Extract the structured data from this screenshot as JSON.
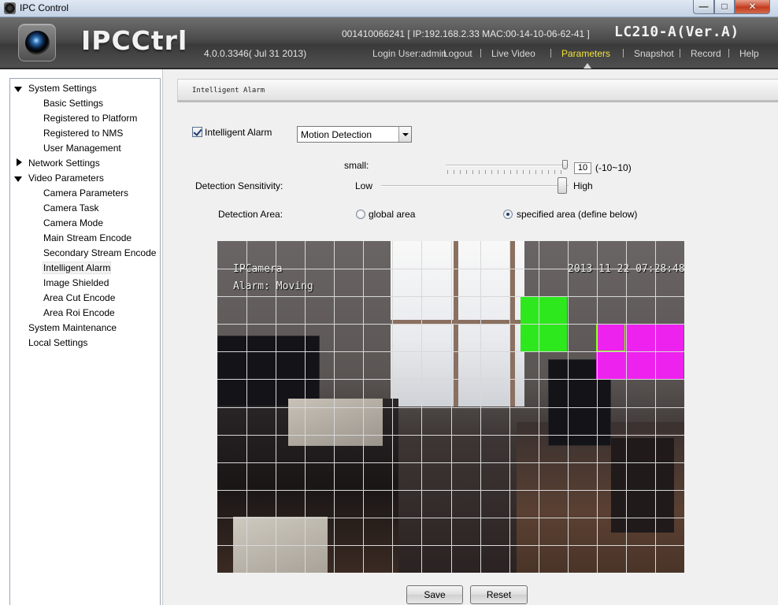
{
  "window": {
    "title": "IPC Control",
    "close_glyph": "✕",
    "max_glyph": "□",
    "min_glyph": "—"
  },
  "header": {
    "brand": "IPCCtrl",
    "version": "4.0.0.3346( Jul 31 2013)",
    "device_info": "001410066241 [ IP:192.168.2.33  MAC:00-14-10-06-62-41 ]",
    "model": "LC210-A(Ver.A)",
    "login_user": "Login User:admin",
    "nav": [
      "Logout",
      "Live Video",
      "Parameters",
      "Snapshot",
      "Record",
      "Help"
    ],
    "active_nav": "Parameters",
    "colors": {
      "active": "#f3e23a",
      "bar": "#4a4a4a"
    }
  },
  "sidebar": {
    "groups": [
      {
        "label": "System Settings",
        "expanded": true,
        "children": [
          "Basic Settings",
          "Registered to Platform",
          "Registered to NMS",
          "User Management"
        ]
      },
      {
        "label": "Network Settings",
        "expanded": false,
        "children": []
      },
      {
        "label": "Video Parameters",
        "expanded": true,
        "children": [
          "Camera Parameters",
          "Camera Task",
          "Camera Mode",
          "Main Stream Encode",
          "Secondary Stream Encode",
          "Intelligent Alarm",
          "Image Shielded",
          "Area Cut Encode",
          "Area Roi Encode"
        ]
      },
      {
        "label": "System Maintenance",
        "expanded": false,
        "children": []
      },
      {
        "label": "Local Settings",
        "expanded": false,
        "children": []
      }
    ],
    "selected": "Intelligent Alarm"
  },
  "main": {
    "section_title": "Intelligent Alarm",
    "alarm_checkbox": {
      "label": "Intelligent Alarm",
      "checked": true
    },
    "alarm_type": {
      "value": "Motion Detection"
    },
    "small": {
      "label": "small:",
      "value": "10",
      "range": "(-10~10)",
      "level": 1.0
    },
    "sensitivity": {
      "label": "Detection Sensitivity:",
      "low": "Low",
      "high": "High",
      "level": 1.0
    },
    "area": {
      "label": "Detection Area:",
      "options": [
        "global area",
        "specified area (define below)"
      ],
      "selected": "specified area (define below)"
    },
    "video": {
      "camera_name": "IPCamera",
      "alarm_text": "Alarm: Moving",
      "timestamp": "2013 11 22 07:28:48",
      "zone_colors": {
        "green": "#2ee81e",
        "magenta": "#ee22ee"
      }
    },
    "buttons": {
      "save": "Save",
      "reset": "Reset"
    }
  }
}
